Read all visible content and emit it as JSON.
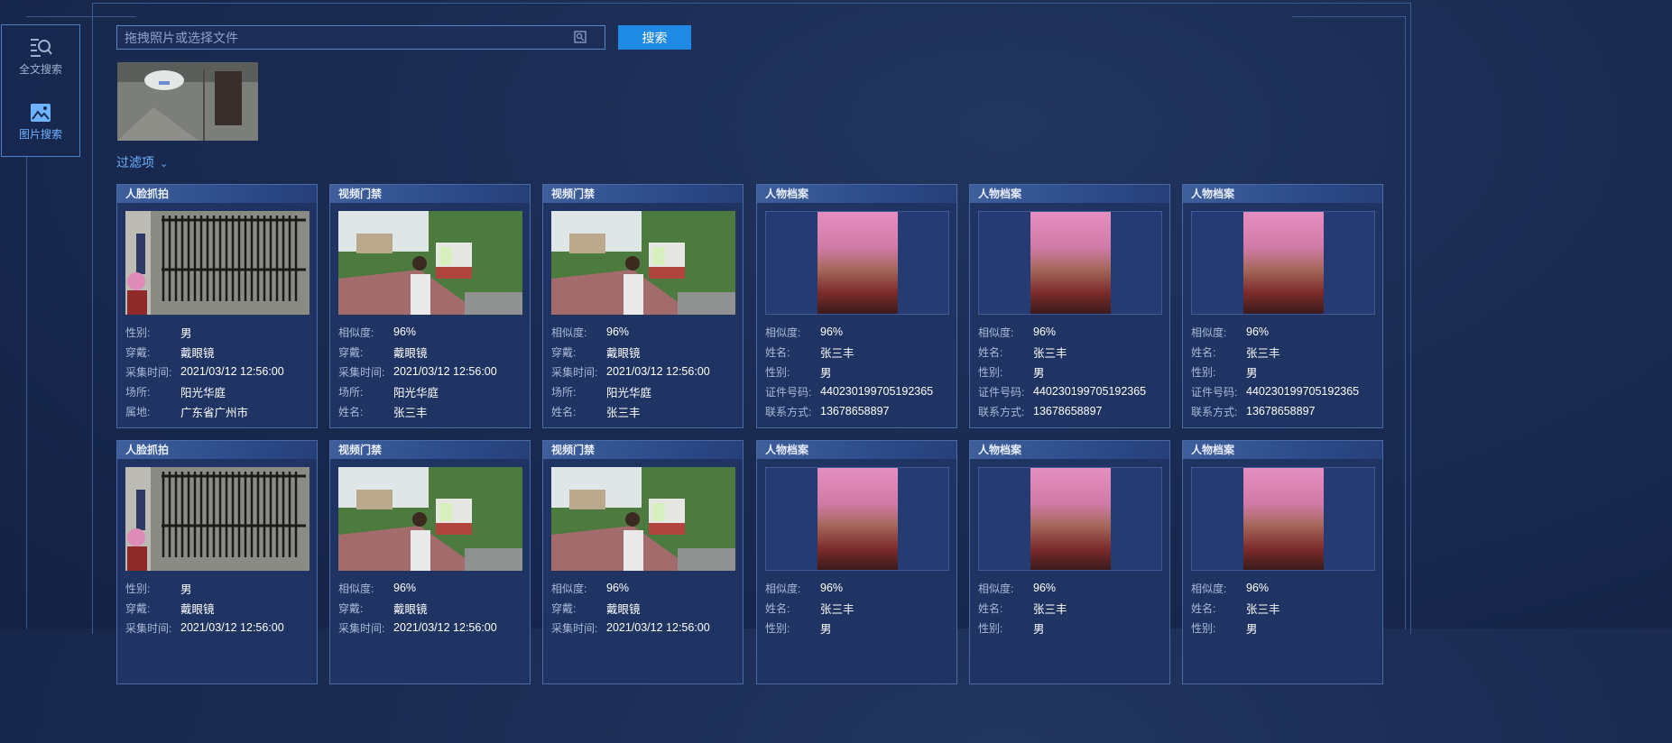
{
  "nav": {
    "items": [
      {
        "label": "全文搜索"
      },
      {
        "label": "图片搜索"
      }
    ]
  },
  "search": {
    "placeholder": "拖拽照片或选择文件",
    "button_label": "搜索"
  },
  "filter": {
    "label": "过滤项"
  },
  "cards": [
    {
      "type": "人脸抓拍",
      "fields": [
        [
          "性别:",
          "男"
        ],
        [
          "穿戴:",
          "戴眼镜"
        ],
        [
          "采集时间:",
          "2021/03/12 12:56:00"
        ],
        [
          "场所:",
          "阳光华庭"
        ],
        [
          "属地:",
          "广东省广州市"
        ]
      ]
    },
    {
      "type": "视频门禁",
      "fields": [
        [
          "相似度:",
          "96%"
        ],
        [
          "穿戴:",
          "戴眼镜"
        ],
        [
          "采集时间:",
          "2021/03/12 12:56:00"
        ],
        [
          "场所:",
          "阳光华庭"
        ],
        [
          "姓名:",
          "张三丰"
        ]
      ]
    },
    {
      "type": "视频门禁",
      "fields": [
        [
          "相似度:",
          "96%"
        ],
        [
          "穿戴:",
          "戴眼镜"
        ],
        [
          "采集时间:",
          "2021/03/12 12:56:00"
        ],
        [
          "场所:",
          "阳光华庭"
        ],
        [
          "姓名:",
          "张三丰"
        ]
      ]
    },
    {
      "type": "人物档案",
      "fields": [
        [
          "相似度:",
          "96%"
        ],
        [
          "姓名:",
          "张三丰"
        ],
        [
          "性别:",
          "男"
        ],
        [
          "证件号码:",
          "440230199705192365"
        ],
        [
          "联系方式:",
          "13678658897"
        ]
      ]
    },
    {
      "type": "人物档案",
      "fields": [
        [
          "相似度:",
          "96%"
        ],
        [
          "姓名:",
          "张三丰"
        ],
        [
          "性别:",
          "男"
        ],
        [
          "证件号码:",
          "440230199705192365"
        ],
        [
          "联系方式:",
          "13678658897"
        ]
      ]
    },
    {
      "type": "人物档案",
      "fields": [
        [
          "相似度:",
          "96%"
        ],
        [
          "姓名:",
          "张三丰"
        ],
        [
          "性别:",
          "男"
        ],
        [
          "证件号码:",
          "440230199705192365"
        ],
        [
          "联系方式:",
          "13678658897"
        ]
      ]
    },
    {
      "type": "人脸抓拍",
      "fields": [
        [
          "性别:",
          "男"
        ],
        [
          "穿戴:",
          "戴眼镜"
        ],
        [
          "采集时间:",
          "2021/03/12 12:56:00"
        ]
      ]
    },
    {
      "type": "视频门禁",
      "fields": [
        [
          "相似度:",
          "96%"
        ],
        [
          "穿戴:",
          "戴眼镜"
        ],
        [
          "采集时间:",
          "2021/03/12 12:56:00"
        ]
      ]
    },
    {
      "type": "视频门禁",
      "fields": [
        [
          "相似度:",
          "96%"
        ],
        [
          "穿戴:",
          "戴眼镜"
        ],
        [
          "采集时间:",
          "2021/03/12 12:56:00"
        ]
      ]
    },
    {
      "type": "人物档案",
      "fields": [
        [
          "相似度:",
          "96%"
        ],
        [
          "姓名:",
          "张三丰"
        ],
        [
          "性别:",
          "男"
        ]
      ]
    },
    {
      "type": "人物档案",
      "fields": [
        [
          "相似度:",
          "96%"
        ],
        [
          "姓名:",
          "张三丰"
        ],
        [
          "性别:",
          "男"
        ]
      ]
    },
    {
      "type": "人物档案",
      "fields": [
        [
          "相似度:",
          "96%"
        ],
        [
          "姓名:",
          "张三丰"
        ],
        [
          "性别:",
          "男"
        ]
      ]
    }
  ]
}
